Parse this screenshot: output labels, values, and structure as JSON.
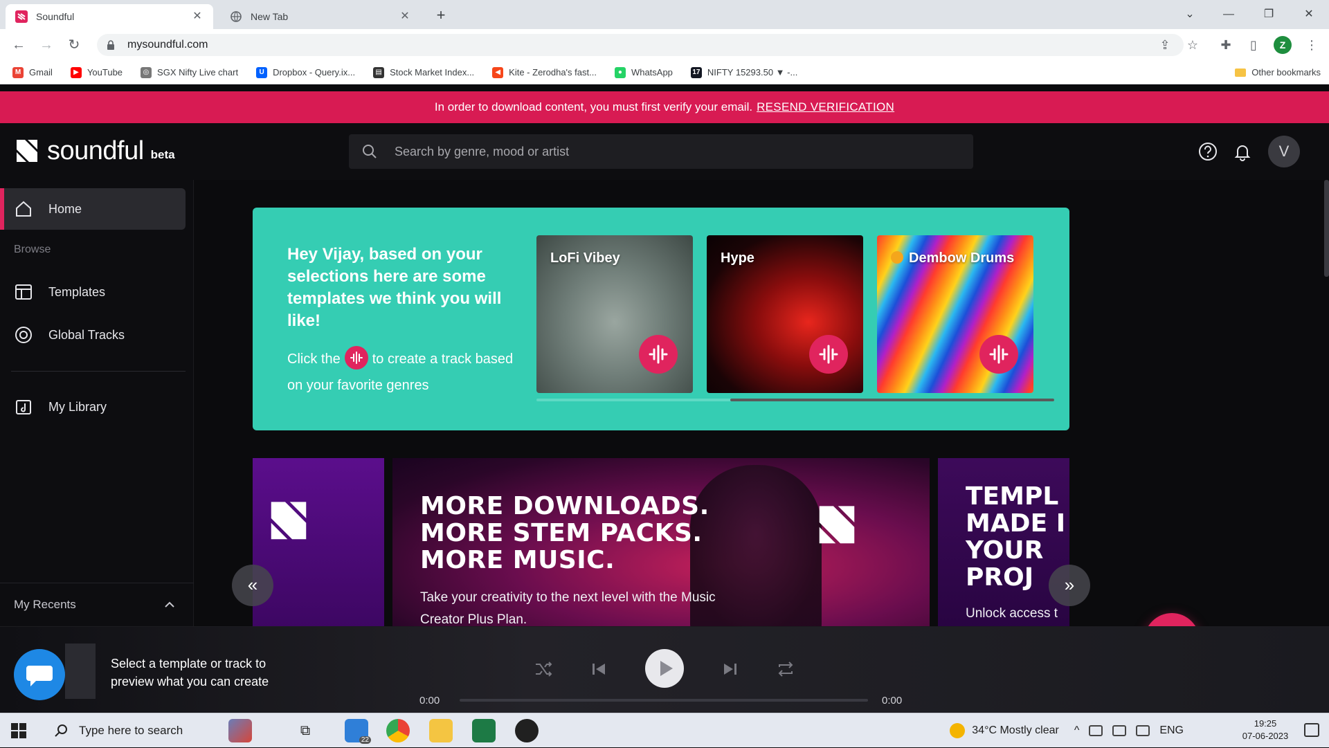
{
  "browser": {
    "tabs": [
      {
        "title": "Soundful",
        "active": true
      },
      {
        "title": "New Tab",
        "active": false
      }
    ],
    "url": "mysoundful.com",
    "profile_initial": "Z",
    "bookmarks": [
      {
        "label": "Gmail",
        "color": "#ea4335",
        "glyph": "M"
      },
      {
        "label": "YouTube",
        "color": "#ff0000",
        "glyph": "▶"
      },
      {
        "label": "SGX Nifty Live chart",
        "color": "#777777",
        "glyph": "◎"
      },
      {
        "label": "Dropbox - Query.ix...",
        "color": "#0061fe",
        "glyph": "U"
      },
      {
        "label": "Stock Market Index...",
        "color": "#333333",
        "glyph": "▤"
      },
      {
        "label": "Kite - Zerodha's fast...",
        "color": "#f6461a",
        "glyph": "◀"
      },
      {
        "label": "WhatsApp",
        "color": "#25d366",
        "glyph": "●"
      },
      {
        "label": "NIFTY 15293.50 ▼ -...",
        "color": "#131722",
        "glyph": "17"
      }
    ],
    "other_bookmarks": "Other bookmarks"
  },
  "banner": {
    "text": "In order to download content, you must first verify your email.",
    "link": "RESEND VERIFICATION"
  },
  "header": {
    "logo_text": "soundful",
    "beta": "beta",
    "search_placeholder": "Search by genre, mood or artist",
    "avatar_initial": "V"
  },
  "sidebar": {
    "home": "Home",
    "browse": "Browse",
    "templates": "Templates",
    "global_tracks": "Global Tracks",
    "my_library": "My Library",
    "my_recents": "My Recents"
  },
  "recommendations": {
    "heading": "Hey Vijay, based on your selections here are some templates we think you will like!",
    "hint_before": "Click the",
    "hint_after": "to create a track based on your favorite genres",
    "cards": [
      {
        "name": "LoFi Vibey",
        "premium": false
      },
      {
        "name": "Hype",
        "premium": false
      },
      {
        "name": "Dembow Drums",
        "premium": true
      }
    ]
  },
  "promos": {
    "main_title_1": "MORE DOWNLOADS.",
    "main_title_2": "MORE STEM PACKS.",
    "main_title_3": "MORE MUSIC.",
    "main_sub": "Take your creativity to the next level with the Music Creator Plus Plan.",
    "right_title_1": "TEMPL",
    "right_title_2": "MADE I",
    "right_title_3": "YOUR",
    "right_title_4": "PROJ",
    "right_sub": "Unlock access t"
  },
  "player": {
    "prompt": "Select a template or track to preview what you can create",
    "time_start": "0:00",
    "time_end": "0:00",
    "progress": 0
  },
  "taskbar": {
    "search_placeholder": "Type here to search",
    "mail_badge": "22",
    "weather": "34°C  Mostly clear",
    "language": "ENG",
    "time": "19:25",
    "date": "07-06-2023"
  },
  "colors": {
    "accent": "#e0245e",
    "teal": "#35cdb3",
    "banner": "#d81b53"
  }
}
